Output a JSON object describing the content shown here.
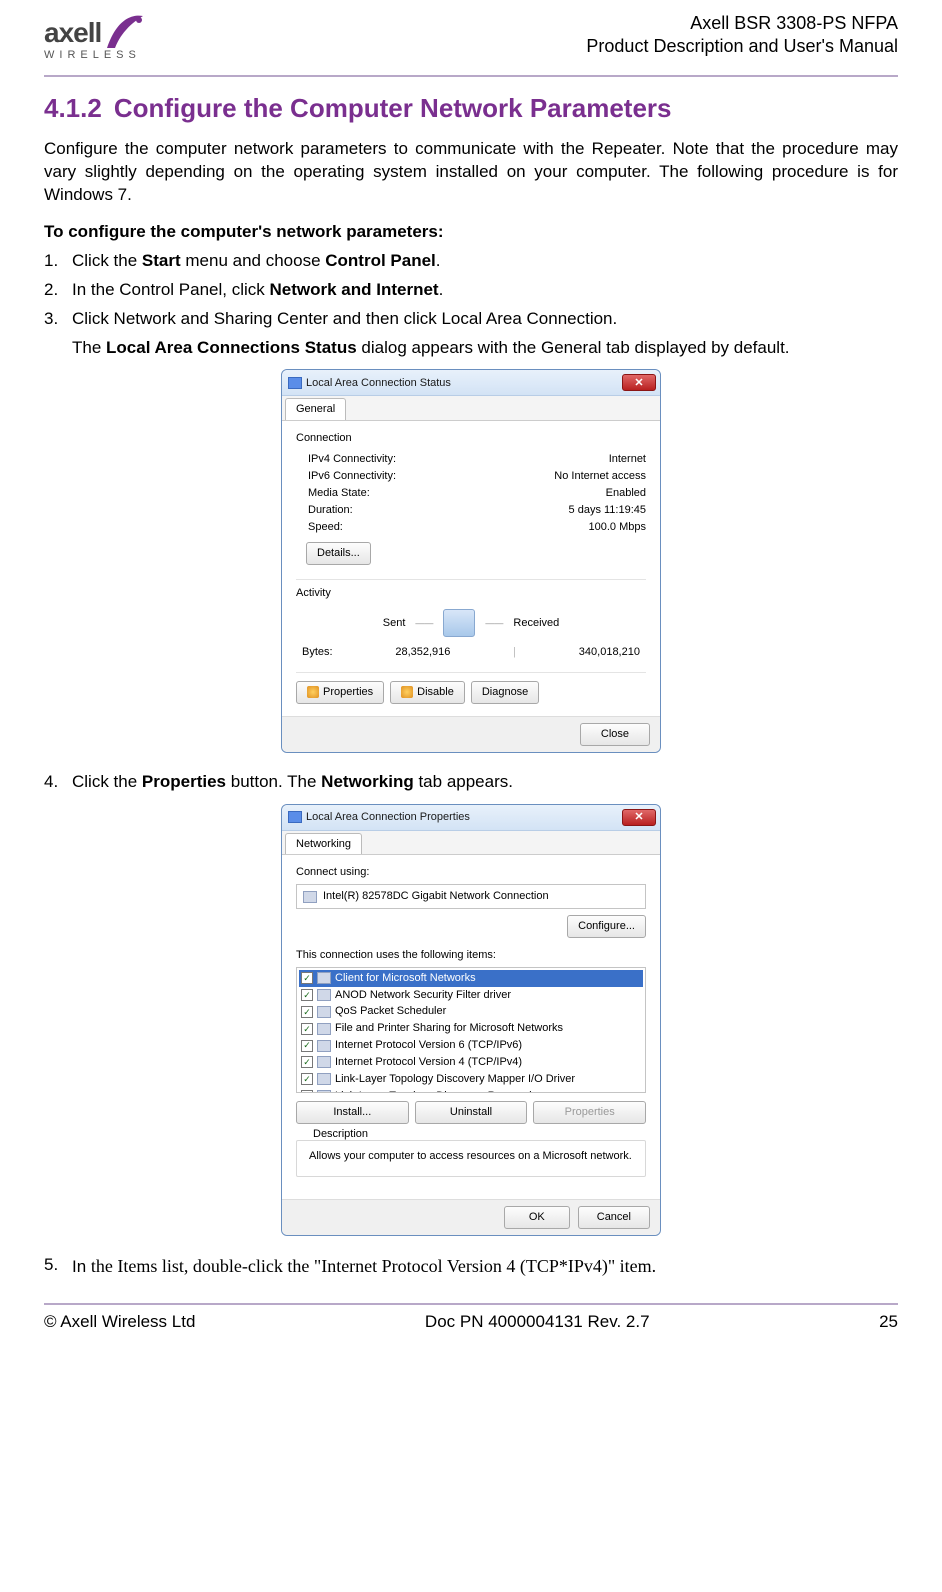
{
  "header": {
    "logo_top": "axell",
    "logo_bottom": "WIRELESS",
    "right_line1": "Axell BSR 3308-PS NFPA",
    "right_line2": "Product Description and User's Manual"
  },
  "section": {
    "number": "4.1.2",
    "title": "Configure the Computer Network Parameters"
  },
  "intro": "Configure the computer network parameters to communicate with the Repeater. Note that the procedure may vary slightly depending on the operating system installed on your computer. The following procedure is for Windows 7.",
  "subhead": "To configure the computer's network parameters:",
  "steps_a": [
    {
      "num": "1.",
      "pre": "Click the ",
      "b1": "Start",
      "mid1": " menu and choose ",
      "b2": "Control Panel",
      "post": "."
    },
    {
      "num": "2.",
      "pre": "In the Control Panel, click ",
      "b1": "Network and Internet",
      "post": "."
    },
    {
      "num": "3.",
      "pre": "Click Network and Sharing Center and then click Local Area Connection.",
      "post": ""
    }
  ],
  "step3_note_pre": "The ",
  "step3_note_b": "Local Area Connections Status",
  "step3_note_post": " dialog appears with the General tab displayed by default.",
  "dlg1": {
    "title": "Local Area Connection Status",
    "tab": "General",
    "group1_label": "Connection",
    "rows": [
      {
        "k": "IPv4 Connectivity:",
        "v": "Internet"
      },
      {
        "k": "IPv6 Connectivity:",
        "v": "No Internet access"
      },
      {
        "k": "Media State:",
        "v": "Enabled"
      },
      {
        "k": "Duration:",
        "v": "5 days 11:19:45"
      },
      {
        "k": "Speed:",
        "v": "100.0 Mbps"
      }
    ],
    "details_btn": "Details...",
    "group2_label": "Activity",
    "sent": "Sent",
    "received": "Received",
    "bytes_label": "Bytes:",
    "bytes_sent": "28,352,916",
    "bytes_recv": "340,018,210",
    "btn_props": "Properties",
    "btn_disable": "Disable",
    "btn_diag": "Diagnose",
    "btn_close": "Close"
  },
  "step4": {
    "num": "4.",
    "pre": "Click the ",
    "b1": "Properties",
    "mid": " button. The ",
    "b2": "Networking",
    "post": " tab appears."
  },
  "dlg2": {
    "title": "Local Area Connection Properties",
    "tab": "Networking",
    "connect_using": "Connect using:",
    "adapter": "Intel(R) 82578DC Gigabit Network Connection",
    "configure_btn": "Configure...",
    "list_label": "This connection uses the following items:",
    "items": [
      "Client for Microsoft Networks",
      "ANOD Network Security Filter driver",
      "QoS Packet Scheduler",
      "File and Printer Sharing for Microsoft Networks",
      "Internet Protocol Version 6 (TCP/IPv6)",
      "Internet Protocol Version 4 (TCP/IPv4)",
      "Link-Layer Topology Discovery Mapper I/O Driver",
      "Link-Layer Topology Discovery Responder"
    ],
    "btn_install": "Install...",
    "btn_uninstall": "Uninstall",
    "btn_props": "Properties",
    "desc_label": "Description",
    "desc_text": "Allows your computer to access resources on a Microsoft network.",
    "btn_ok": "OK",
    "btn_cancel": "Cancel"
  },
  "step5": {
    "num": "5.",
    "pre": "In ",
    "mid": "the Items list, double-click the \"Internet Protocol Version 4 (TCP*IPv4)\" item."
  },
  "footer": {
    "left": "© Axell Wireless Ltd",
    "center": "Doc PN 4000004131 Rev. 2.7",
    "right": "25"
  }
}
